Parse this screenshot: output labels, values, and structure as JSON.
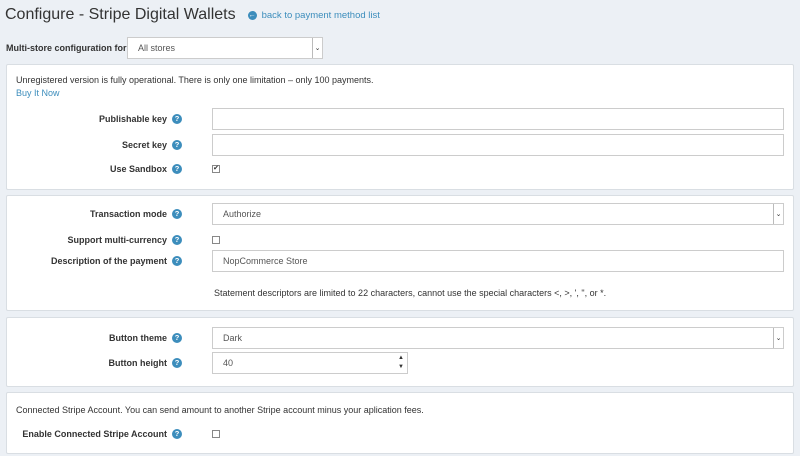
{
  "header": {
    "title": "Configure - Stripe Digital Wallets",
    "back_link": "back to payment method list",
    "back_icon": "arrow-left-circle-icon"
  },
  "store": {
    "label": "Multi-store configuration for",
    "value": "All stores"
  },
  "panel1": {
    "notice": "Unregistered version is fully operational. There is only one limitation – only 100 payments.",
    "buy_link": "Buy It Now",
    "publishable_key_label": "Publishable key",
    "publishable_key_value": "",
    "secret_key_label": "Secret key",
    "secret_key_value": "",
    "use_sandbox_label": "Use Sandbox",
    "use_sandbox_checked": true
  },
  "panel2": {
    "transaction_mode_label": "Transaction mode",
    "transaction_mode_value": "Authorize",
    "multi_currency_label": "Support multi-currency",
    "multi_currency_checked": false,
    "description_label": "Description of the payment",
    "description_value": "NopCommerce Store",
    "descriptor_hint": "Statement descriptors are limited to 22 characters, cannot use the special characters <, >, ', \", or *."
  },
  "panel3": {
    "button_theme_label": "Button theme",
    "button_theme_value": "Dark",
    "button_height_label": "Button height",
    "button_height_value": "40"
  },
  "panel4": {
    "notice": "Connected Stripe Account. You can send amount to another Stripe account minus your aplication fees.",
    "enable_connected_label": "Enable Connected Stripe Account",
    "enable_connected_checked": false
  },
  "icons": {
    "help": "question-circle-icon",
    "check": "checkmark-icon",
    "caret": "chevron-down-icon"
  },
  "colors": {
    "accent": "#3c8dbc",
    "background": "#ecf0f5"
  }
}
